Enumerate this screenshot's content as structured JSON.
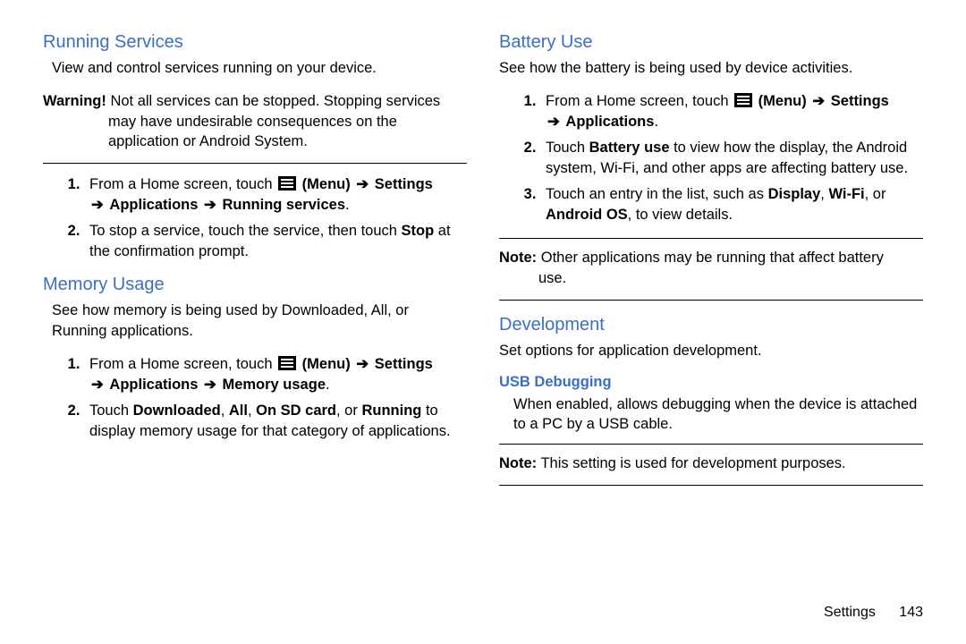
{
  "left": {
    "running_heading": "Running Services",
    "running_intro": "View and control services running on your device.",
    "warning_label": "Warning!",
    "warning_line1": " Not all services can be stopped. Stopping services",
    "warning_line2": "may have undesirable consequences on the",
    "warning_line3": "application or Android System.",
    "rs_step1_a": "From a Home screen, touch ",
    "rs_step1_b": "(Menu)",
    "rs_step1_c": "Settings",
    "rs_step1_d": "Applications",
    "rs_step1_e": "Running services",
    "rs_step2_a": "To stop a service, touch the service, then touch ",
    "rs_step2_stop": "Stop",
    "rs_step2_b": " at the confirmation prompt.",
    "memory_heading": "Memory Usage",
    "memory_intro": "See how memory is being used by Downloaded, All, or Running applications.",
    "mu_step1_a": "From a Home screen, touch ",
    "mu_step1_b": "(Menu)",
    "mu_step1_c": "Settings",
    "mu_step1_d": "Applications",
    "mu_step1_e": "Memory usage",
    "mu_step2_a": "Touch ",
    "mu_step2_b": "Downloaded",
    "mu_step2_c": ", ",
    "mu_step2_d": "All",
    "mu_step2_e": ", ",
    "mu_step2_f": "On SD card",
    "mu_step2_g": ", or ",
    "mu_step2_h": "Running",
    "mu_step2_i": " to display memory usage for that category of applications."
  },
  "right": {
    "battery_heading": "Battery Use",
    "battery_intro": "See how the battery is being used by device activities.",
    "bu_step1_a": "From a Home screen, touch ",
    "bu_step1_b": "(Menu)",
    "bu_step1_c": "Settings",
    "bu_step1_d": "Applications",
    "bu_step2_a": "Touch ",
    "bu_step2_b": "Battery use",
    "bu_step2_c": " to view how the display, the Android system, Wi-Fi, and other apps are affecting battery use.",
    "bu_step3_a": "Touch an entry in the list, such as ",
    "bu_step3_b": "Display",
    "bu_step3_c": ", ",
    "bu_step3_d": "Wi-Fi",
    "bu_step3_e": ", or ",
    "bu_step3_f": "Android OS",
    "bu_step3_g": ", to view details.",
    "note1_label": "Note:",
    "note1_line1": " Other applications may be running that affect battery",
    "note1_line2": "use.",
    "dev_heading": "Development",
    "dev_intro": "Set options for application development.",
    "usb_heading": "USB Debugging",
    "usb_body": "When enabled, allows debugging when the device is attached to a PC by a USB cable.",
    "note2_label": "Note:",
    "note2_body": " This setting is used for development purposes."
  },
  "arrow": "➔",
  "period": ".",
  "footer": {
    "section": "Settings",
    "page": "143"
  }
}
